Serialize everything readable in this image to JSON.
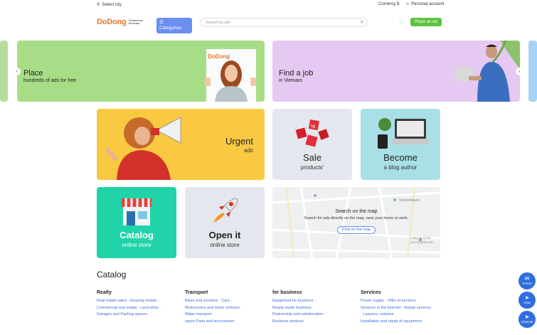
{
  "topbar": {
    "city": "Select city",
    "currency": "Currency $",
    "account": "Personal account"
  },
  "header": {
    "logo": "DoDong",
    "logo_sub": "Объявления Вьетнама",
    "categories": "Categories",
    "search_placeholder": "Search by ads",
    "place_ad": "Place an ad"
  },
  "banners": [
    {
      "title": "Place",
      "subtitle": "hundreds of ads for free",
      "badge": "DoDong"
    },
    {
      "title": "Find a job",
      "subtitle": "in Vietnam"
    }
  ],
  "tiles": {
    "urgent": {
      "title": "Urgent",
      "subtitle": "ads"
    },
    "sale": {
      "title": "Sale",
      "subtitle": "products'"
    },
    "blog": {
      "title": "Become",
      "subtitle": "a blog author"
    },
    "catalog": {
      "title": "Catalog",
      "subtitle": "online store"
    },
    "open": {
      "title": "Open it",
      "subtitle": "online store"
    },
    "map": {
      "title": "Search on the map",
      "subtitle": "Search for ads directly on the map, near your home or work.",
      "button": "Find on the map",
      "label1": "Vietcombank",
      "label2": "Công Ty Cổ Đ...",
      "label3": "Lực Khánh Hòa"
    }
  },
  "catalog": {
    "title": "Catalog",
    "columns": [
      {
        "heading": "Realty",
        "lines": [
          "Real estate sales · housing rentals ·",
          "Commercial real estate · Land plots ·",
          "Garages and Parking spaces"
        ]
      },
      {
        "heading": "Transport",
        "lines": [
          "Bikes and scooters · Cars ·",
          "Motorcycles and motor vehicles ·",
          "Water transport ·",
          "spare Parts and accessories"
        ]
      },
      {
        "heading": "for business",
        "lines": [
          "Equipment for business ·",
          "Ready-made business ·",
          "Partnership and collaboration ·",
          "Business services"
        ]
      },
      {
        "heading": "Services",
        "lines": [
          "Power supply · Offer of services ·",
          "Services in the Internet · Repair services",
          "· Lawyers, notaries ·",
          "Installation and repair of equipment"
        ]
      }
    ]
  },
  "floating": {
    "forum": "Forum",
    "chat": "Chat",
    "channel": "Channel"
  }
}
